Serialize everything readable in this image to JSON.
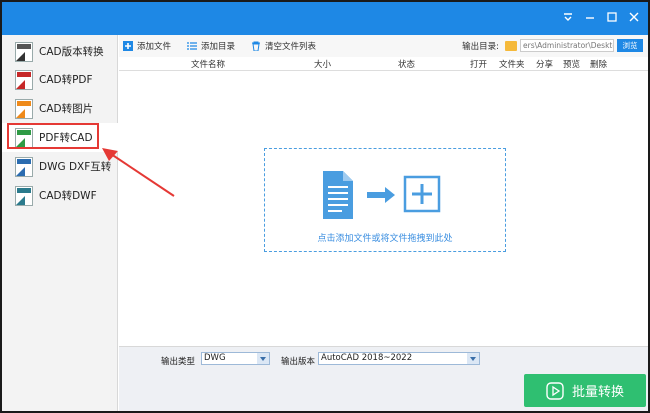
{
  "window": {
    "controls": [
      "menu-icon",
      "minimize-icon",
      "maximize-icon",
      "close-icon"
    ],
    "accent": "#1e88e5"
  },
  "sidebar": {
    "items": [
      {
        "label": "CAD版本转换",
        "icon": "cad-version-icon",
        "color": "#333333"
      },
      {
        "label": "CAD转PDF",
        "icon": "cad-to-pdf-icon",
        "color": "#c62828"
      },
      {
        "label": "CAD转图片",
        "icon": "cad-to-image-icon",
        "color": "#ef8a1a"
      },
      {
        "label": "PDF转CAD",
        "icon": "pdf-to-cad-icon",
        "color": "#2e9b45"
      },
      {
        "label": "DWG DXF互转",
        "icon": "dwg-dxf-icon",
        "color": "#2b6cb0"
      },
      {
        "label": "CAD转DWF",
        "icon": "cad-to-dwf-icon",
        "color": "#2b7a8c"
      }
    ],
    "active_index": 3
  },
  "toolbar": {
    "add_file": "添加文件",
    "add_folder": "添加目录",
    "clear_list": "清空文件列表",
    "output_dir_label": "输出目录:",
    "output_dir_value": "ers\\Administrator\\Desktop",
    "browse": "浏览"
  },
  "table": {
    "columns": [
      "文件名称",
      "大小",
      "状态",
      "打开",
      "文件夹",
      "分享",
      "预览",
      "删除"
    ]
  },
  "dropzone": {
    "hint": "点击添加文件或将文件拖拽到此处"
  },
  "bottom": {
    "output_type_label": "输出类型",
    "output_type_value": "DWG",
    "output_version_label": "输出版本",
    "output_version_value": "AutoCAD 2018~2022",
    "convert_label": "批量转换"
  }
}
